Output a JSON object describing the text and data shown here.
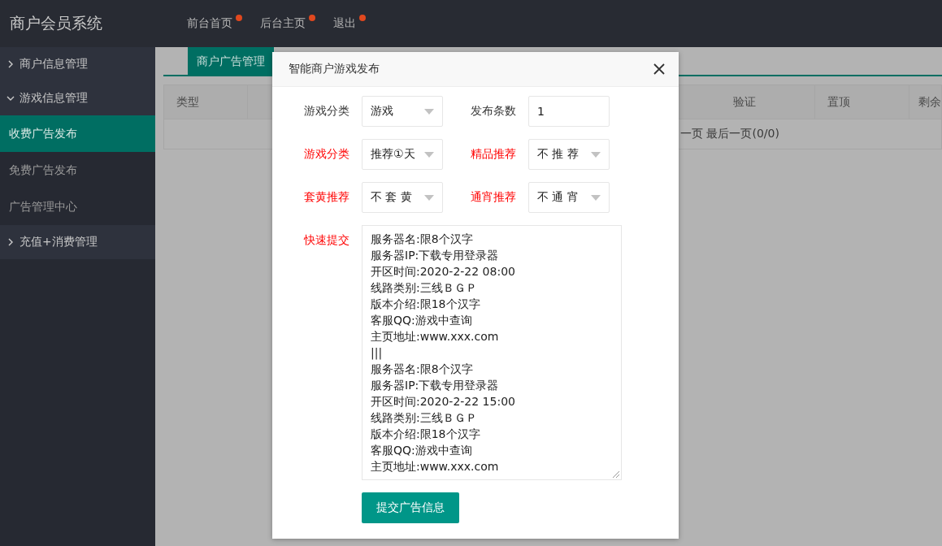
{
  "header": {
    "title": "商户会员系统",
    "nav": [
      {
        "label": "前台首页",
        "dot": true
      },
      {
        "label": "后台主页",
        "dot": true
      },
      {
        "label": "退出",
        "dot": true
      }
    ]
  },
  "sidebar": {
    "items": [
      {
        "label": "商户信息管理",
        "expanded": false
      },
      {
        "label": "游戏信息管理",
        "expanded": true,
        "children": [
          {
            "label": "收费广告发布",
            "selected": true
          },
          {
            "label": "免费广告发布",
            "selected": false
          },
          {
            "label": "广告管理中心",
            "selected": false
          }
        ]
      },
      {
        "label": "充值+消费管理",
        "expanded": false
      }
    ]
  },
  "tabs": [
    {
      "label": "商户广告管理",
      "selected": true
    }
  ],
  "table": {
    "columns": [
      "类型",
      "验证",
      "置顶",
      "剩余"
    ],
    "pager": "一页 最后一页(0/0)"
  },
  "dialog": {
    "title": "智能商户游戏发布",
    "rows": [
      [
        {
          "label": "游戏分类",
          "highlight": false,
          "kind": "select",
          "value": "游戏"
        },
        {
          "label": "发布条数",
          "highlight": false,
          "kind": "input",
          "value": "1"
        }
      ],
      [
        {
          "label": "游戏分类",
          "highlight": true,
          "kind": "select",
          "value": "推荐①天"
        },
        {
          "label": "精品推荐",
          "highlight": true,
          "kind": "select",
          "value": "不 推 荐"
        }
      ],
      [
        {
          "label": "套黄推荐",
          "highlight": true,
          "kind": "select",
          "value": "不 套 黄"
        },
        {
          "label": "通宵推荐",
          "highlight": true,
          "kind": "select",
          "value": "不 通 宵"
        }
      ]
    ],
    "quick": {
      "label": "快速提交",
      "highlight": true,
      "lines": [
        "服务器名:限8个汉字",
        "服务器IP:下载专用登录器",
        "开区时间:2020-2-22 08:00",
        "线路类别:三线ＢＧＰ",
        "版本介绍:限18个汉字",
        "客服QQ:游戏中查询",
        "主页地址:www.xxx.com",
        "|||",
        "服务器名:限8个汉字",
        "服务器IP:下载专用登录器",
        "开区时间:2020-2-22 15:00",
        "线路类别:三线ＢＧＰ",
        "版本介绍:限18个汉字",
        "客服QQ:游戏中查询",
        "主页地址:www.xxx.com"
      ]
    },
    "submit": "提交广告信息"
  }
}
